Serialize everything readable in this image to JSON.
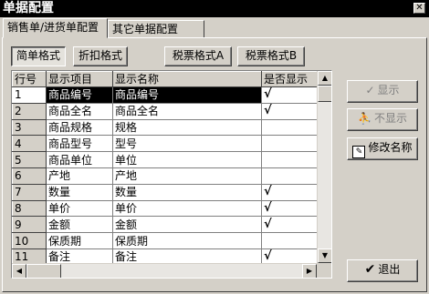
{
  "window": {
    "title": "单据配置",
    "close_glyph": "✕"
  },
  "tabs": [
    {
      "label": "销售单/进货单配置",
      "active": true
    },
    {
      "label": "其它单据配置",
      "active": false
    }
  ],
  "format_buttons": [
    {
      "label": "简单格式",
      "pressed": true
    },
    {
      "label": "折扣格式",
      "pressed": false
    },
    {
      "label": "税票格式A",
      "pressed": false
    },
    {
      "label": "税票格式B",
      "pressed": false
    }
  ],
  "grid": {
    "columns": [
      "行号",
      "显示项目",
      "显示名称",
      "是否显示"
    ],
    "rows": [
      {
        "no": "1",
        "item": "商品编号",
        "name": "商品编号",
        "show": "√",
        "selected": true
      },
      {
        "no": "2",
        "item": "商品全名",
        "name": "商品全名",
        "show": "√",
        "selected": false
      },
      {
        "no": "3",
        "item": "商品规格",
        "name": "规格",
        "show": "",
        "selected": false
      },
      {
        "no": "4",
        "item": "商品型号",
        "name": "型号",
        "show": "",
        "selected": false
      },
      {
        "no": "5",
        "item": "商品单位",
        "name": "单位",
        "show": "",
        "selected": false
      },
      {
        "no": "6",
        "item": "产地",
        "name": "产地",
        "show": "",
        "selected": false
      },
      {
        "no": "7",
        "item": "数量",
        "name": "数量",
        "show": "√",
        "selected": false
      },
      {
        "no": "8",
        "item": "单价",
        "name": "单价",
        "show": "√",
        "selected": false
      },
      {
        "no": "9",
        "item": "金额",
        "name": "金额",
        "show": "√",
        "selected": false
      },
      {
        "no": "10",
        "item": "保质期",
        "name": "保质期",
        "show": "",
        "selected": false
      },
      {
        "no": "11",
        "item": "备注",
        "name": "备注",
        "show": "√",
        "selected": false
      }
    ]
  },
  "side_buttons": {
    "show": {
      "label": "显示",
      "icon": "checkmark-icon",
      "enabled": false
    },
    "hide": {
      "label": "不显示",
      "icon": "person-icon",
      "enabled": false
    },
    "rename": {
      "label": "修改名称",
      "icon": "edit-icon",
      "enabled": true
    },
    "exit": {
      "label": "退出",
      "icon": "checkmark-icon",
      "enabled": true
    }
  }
}
